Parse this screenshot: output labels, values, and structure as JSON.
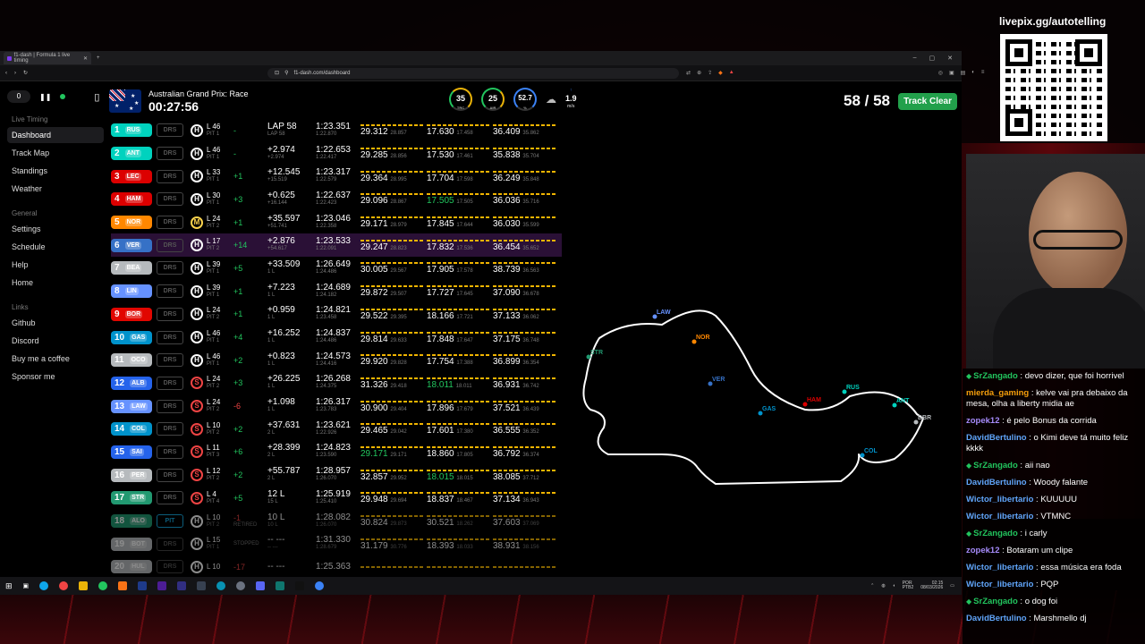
{
  "overlay": {
    "qr_title": "livepix.gg/autotelling"
  },
  "browser": {
    "tab_title": "f1-dash | Formula 1 live timing",
    "url": "f1-dash.com/dashboard"
  },
  "sidebar": {
    "delay": "0",
    "group_live": "Live Timing",
    "live_items": [
      {
        "label": "Dashboard"
      },
      {
        "label": "Track Map"
      },
      {
        "label": "Standings"
      },
      {
        "label": "Weather"
      }
    ],
    "group_general": "General",
    "general_items": [
      {
        "label": "Settings"
      },
      {
        "label": "Schedule"
      },
      {
        "label": "Help"
      },
      {
        "label": "Home"
      }
    ],
    "group_links": "Links",
    "link_items": [
      {
        "label": "Github"
      },
      {
        "label": "Discord"
      },
      {
        "label": "Buy me a coffee"
      },
      {
        "label": "Sponsor me"
      }
    ]
  },
  "header": {
    "race_title": "Australian Grand Prix: Race",
    "clock": "00:27:56",
    "track_temp": "35",
    "track_temp_label": "TRC",
    "air_temp": "25",
    "air_temp_label": "AIR",
    "humidity": "52.7",
    "humidity_label": "%",
    "wind": "1.9",
    "wind_unit": "m/s",
    "laps": "58 / 58",
    "track_status": "Track Clear"
  },
  "drivers": [
    {
      "pos": "1",
      "code": "RUS",
      "color": "#00d2be",
      "drs": "DRS",
      "tyre": "H",
      "lap": "L 46",
      "pit": "PIT 1",
      "gain": "-",
      "gain2": "",
      "gap": "LAP 58",
      "gap2": "LAP 58",
      "best": "1:23.351",
      "best2": "1:22.870",
      "s1": "29.312",
      "s1b": "28.857",
      "s2": "17.630",
      "s2b": "17.458",
      "s3": "36.409",
      "s3b": "35.862"
    },
    {
      "pos": "2",
      "code": "ANT",
      "color": "#00d2be",
      "drs": "DRS",
      "tyre": "H",
      "lap": "L 46",
      "pit": "PIT 1",
      "gain": "-",
      "gain2": "",
      "gap": "+2.974",
      "gap2": "+2.974",
      "best": "1:22.653",
      "best2": "1:22.417",
      "s1": "29.285",
      "s1b": "28.856",
      "s2": "17.530",
      "s2b": "17.461",
      "s3": "35.838",
      "s3b": "35.704"
    },
    {
      "pos": "3",
      "code": "LEC",
      "color": "#dc0000",
      "drs": "DRS",
      "tyre": "H",
      "lap": "L 33",
      "pit": "PIT 1",
      "gain": "+1",
      "gain2": "",
      "gap": "+12.545",
      "gap2": "+15.519",
      "best": "1:23.317",
      "best2": "1:22.579",
      "s1": "29.364",
      "s1b": "28.995",
      "s2": "17.704",
      "s2b": "17.598",
      "s3": "36.249",
      "s3b": "35.848"
    },
    {
      "pos": "4",
      "code": "HAM",
      "color": "#dc0000",
      "drs": "DRS",
      "tyre": "H",
      "lap": "L 30",
      "pit": "PIT 1",
      "gain": "+3",
      "gain2": "",
      "gap": "+0.625",
      "gap2": "+16.144",
      "best": "1:22.637",
      "best2": "1:22.423",
      "s1": "29.096",
      "s1b": "28.867",
      "s2": "17.505",
      "s2b": "17.505",
      "s3": "36.036",
      "s3b": "35.716"
    },
    {
      "pos": "5",
      "code": "NOR",
      "color": "#ff8700",
      "drs": "DRS",
      "tyre": "M",
      "lap": "L 24",
      "pit": "PIT 2",
      "gain": "+1",
      "gain2": "",
      "gap": "+35.597",
      "gap2": "+51.741",
      "best": "1:23.046",
      "best2": "1:22.358",
      "s1": "29.171",
      "s1b": "28.979",
      "s2": "17.845",
      "s2b": "17.644",
      "s3": "36.030",
      "s3b": "35.599"
    },
    {
      "pos": "6",
      "code": "VER",
      "color": "#3671c6",
      "drs": "DRS",
      "tyre": "H",
      "lap": "L 17",
      "pit": "PIT 2",
      "gain": "+14",
      "gain2": "",
      "gap": "+2.876",
      "gap2": "+54.617",
      "best": "1:23.533",
      "best2": "1:22.091",
      "s1": "29.247",
      "s1b": "28.823",
      "s2": "17.832",
      "s2b": "17.536",
      "s3": "36.454",
      "s3b": "35.652"
    },
    {
      "pos": "7",
      "code": "BEA",
      "color": "#b6babd",
      "drs": "DRS",
      "tyre": "H",
      "lap": "L 39",
      "pit": "PIT 1",
      "gain": "+5",
      "gain2": "",
      "gap": "+33.509",
      "gap2": "1 L",
      "best": "1:26.649",
      "best2": "1:24.486",
      "s1": "30.005",
      "s1b": "29.567",
      "s2": "17.905",
      "s2b": "17.578",
      "s3": "38.739",
      "s3b": "36.563"
    },
    {
      "pos": "8",
      "code": "LIN",
      "color": "#6692ff",
      "drs": "DRS",
      "tyre": "H",
      "lap": "L 39",
      "pit": "PIT 1",
      "gain": "+1",
      "gain2": "",
      "gap": "+7.223",
      "gap2": "1 L",
      "best": "1:24.689",
      "best2": "1:24.182",
      "s1": "29.872",
      "s1b": "29.507",
      "s2": "17.727",
      "s2b": "17.645",
      "s3": "37.090",
      "s3b": "36.678"
    },
    {
      "pos": "9",
      "code": "BOR",
      "color": "#e10600",
      "drs": "DRS",
      "tyre": "H",
      "lap": "L 24",
      "pit": "PIT 2",
      "gain": "+1",
      "gain2": "",
      "gap": "+0.959",
      "gap2": "1 L",
      "best": "1:24.821",
      "best2": "1:23.458",
      "s1": "29.522",
      "s1b": "29.395",
      "s2": "18.166",
      "s2b": "17.721",
      "s3": "37.133",
      "s3b": "36.062"
    },
    {
      "pos": "10",
      "code": "GAS",
      "color": "#0093cc",
      "drs": "DRS",
      "tyre": "H",
      "lap": "L 46",
      "pit": "PIT 1",
      "gain": "+4",
      "gain2": "",
      "gap": "+16.252",
      "gap2": "1 L",
      "best": "1:24.837",
      "best2": "1:24.486",
      "s1": "29.814",
      "s1b": "29.633",
      "s2": "17.848",
      "s2b": "17.647",
      "s3": "37.175",
      "s3b": "36.748"
    },
    {
      "pos": "11",
      "code": "OCO",
      "color": "#b6babd",
      "drs": "DRS",
      "tyre": "H",
      "lap": "L 46",
      "pit": "PIT 1",
      "gain": "+2",
      "gain2": "",
      "gap": "+0.823",
      "gap2": "1 L",
      "best": "1:24.573",
      "best2": "1:24.416",
      "s1": "29.920",
      "s1b": "29.828",
      "s2": "17.754",
      "s2b": "17.388",
      "s3": "36.899",
      "s3b": "36.354"
    },
    {
      "pos": "12",
      "code": "ALB",
      "color": "#2563eb",
      "drs": "DRS",
      "tyre": "S",
      "lap": "L 24",
      "pit": "PIT 2",
      "gain": "+3",
      "gain2": "",
      "gap": "+26.225",
      "gap2": "1 L",
      "best": "1:26.268",
      "best2": "1:24.375",
      "s1": "31.326",
      "s1b": "29.418",
      "s2": "18.011",
      "s2b": "18.011",
      "s3": "36.931",
      "s3b": "36.742"
    },
    {
      "pos": "13",
      "code": "LAW",
      "color": "#6692ff",
      "drs": "DRS",
      "tyre": "S",
      "lap": "L 24",
      "pit": "PIT 2",
      "gain": "-6",
      "gain2": "",
      "gap": "+1.098",
      "gap2": "1 L",
      "best": "1:26.317",
      "best2": "1:23.783",
      "s1": "30.900",
      "s1b": "29.404",
      "s2": "17.896",
      "s2b": "17.679",
      "s3": "37.521",
      "s3b": "36.439"
    },
    {
      "pos": "14",
      "code": "COL",
      "color": "#0093cc",
      "drs": "DRS",
      "tyre": "S",
      "lap": "L 10",
      "pit": "PIT 2",
      "gain": "+2",
      "gain2": "",
      "gap": "+37.631",
      "gap2": "2 L",
      "best": "1:23.621",
      "best2": "1:22.926",
      "s1": "29.465",
      "s1b": "29.042",
      "s2": "17.601",
      "s2b": "17.380",
      "s3": "36.555",
      "s3b": "36.352"
    },
    {
      "pos": "15",
      "code": "SAI",
      "color": "#2563eb",
      "drs": "DRS",
      "tyre": "S",
      "lap": "L 11",
      "pit": "PIT 3",
      "gain": "+6",
      "gain2": "",
      "gap": "+28.399",
      "gap2": "2 L",
      "best": "1:24.823",
      "best2": "1:23.590",
      "s1": "29.171",
      "s1b": "29.171",
      "s2": "18.860",
      "s2b": "17.805",
      "s3": "36.792",
      "s3b": "36.374"
    },
    {
      "pos": "16",
      "code": "PER",
      "color": "#b6babd",
      "drs": "DRS",
      "tyre": "S",
      "lap": "L 12",
      "pit": "PIT 2",
      "gain": "+2",
      "gain2": "",
      "gap": "+55.787",
      "gap2": "2 L",
      "best": "1:28.957",
      "best2": "1:26.070",
      "s1": "32.857",
      "s1b": "29.952",
      "s2": "18.015",
      "s2b": "18.015",
      "s3": "38.085",
      "s3b": "37.712"
    },
    {
      "pos": "17",
      "code": "STR",
      "color": "#229971",
      "drs": "DRS",
      "tyre": "S",
      "lap": "L 4",
      "pit": "PIT 4",
      "gain": "+5",
      "gain2": "",
      "gap": "12 L",
      "gap2": "15 L",
      "best": "1:25.919",
      "best2": "1:25.410",
      "s1": "29.948",
      "s1b": "29.694",
      "s2": "18.837",
      "s2b": "18.467",
      "s3": "37.134",
      "s3b": "36.943"
    },
    {
      "pos": "18",
      "code": "ALO",
      "color": "#229971",
      "drs": "PIT",
      "tyre": "H",
      "lap": "L 10",
      "pit": "PIT 2",
      "gain": "-1",
      "gain2": "RETIRED",
      "gap": "10 L",
      "gap2": "10 L",
      "best": "1:28.082",
      "best2": "1:26.070",
      "s1": "30.824",
      "s1b": "29.873",
      "s2": "30.521",
      "s2b": "18.262",
      "s3": "37.603",
      "s3b": "37.069"
    },
    {
      "pos": "19",
      "code": "BOT",
      "color": "#b6babd",
      "drs": "DRS",
      "tyre": "H",
      "lap": "L 15",
      "pit": "PIT 1",
      "gain": "",
      "gain2": "STOPPED",
      "gap": "-- ---",
      "gap2": "-- ---",
      "best": "1:31.330",
      "best2": "1:28.679",
      "s1": "31.179",
      "s1b": "30.776",
      "s2": "18.393",
      "s2b": "18.033",
      "s3": "38.931",
      "s3b": "38.156"
    },
    {
      "pos": "20",
      "code": "HUL",
      "color": "#b6babd",
      "drs": "DRS",
      "tyre": "H",
      "lap": "L 10",
      "pit": "",
      "gain": "-17",
      "gain2": "",
      "gap": "-- ---",
      "gap2": "",
      "best": "1:25.363",
      "best2": "",
      "s1": "",
      "s1b": "",
      "s2": "",
      "s2b": "",
      "s3": "",
      "s3b": ""
    }
  ],
  "map_labels": [
    {
      "code": "LAW",
      "color": "#6692ff"
    },
    {
      "code": "NOR",
      "color": "#ff8700"
    },
    {
      "code": "STR",
      "color": "#229971"
    },
    {
      "code": "VER",
      "color": "#3671c6"
    },
    {
      "code": "GAS",
      "color": "#0093cc"
    },
    {
      "code": "HAM",
      "color": "#dc0000"
    },
    {
      "code": "RUS",
      "color": "#00d2be"
    },
    {
      "code": "ANT",
      "color": "#00d2be"
    },
    {
      "code": "DBR",
      "color": "#b6babd"
    },
    {
      "code": "COL",
      "color": "#0093cc"
    }
  ],
  "taskbar": {
    "lang": "POR",
    "lang2": "PTB2",
    "time": "02:15",
    "date": "08/03/2026"
  },
  "chat": [
    {
      "user": "SrZangado",
      "color": "#22c55e",
      "gem": true,
      "text": "devo dizer, que foi horrivel"
    },
    {
      "user": "mierda_gaming",
      "color": "#f59e0b",
      "gem": false,
      "text": "kelve vai pra debaixo da mesa, olha a liberty midia ae"
    },
    {
      "user": "zopek12",
      "color": "#a78bfa",
      "gem": false,
      "text": "é pelo Bonus da corrida"
    },
    {
      "user": "DavidBertulino",
      "color": "#60a5fa",
      "gem": false,
      "text": "o Kimi deve tá muito feliz kkkk"
    },
    {
      "user": "SrZangado",
      "color": "#22c55e",
      "gem": true,
      "text": "aii nao"
    },
    {
      "user": "DavidBertulino",
      "color": "#60a5fa",
      "gem": false,
      "text": "Woody falante"
    },
    {
      "user": "Wictor_libertario",
      "color": "#60a5fa",
      "gem": false,
      "text": "KUUUUU"
    },
    {
      "user": "Wictor_libertario",
      "color": "#60a5fa",
      "gem": false,
      "text": "VTMNC"
    },
    {
      "user": "SrZangado",
      "color": "#22c55e",
      "gem": true,
      "text": "i carly"
    },
    {
      "user": "zopek12",
      "color": "#a78bfa",
      "gem": false,
      "text": "Botaram um clipe"
    },
    {
      "user": "Wictor_libertario",
      "color": "#60a5fa",
      "gem": false,
      "text": "essa música era foda"
    },
    {
      "user": "Wictor_libertario",
      "color": "#60a5fa",
      "gem": false,
      "text": "PQP"
    },
    {
      "user": "SrZangado",
      "color": "#22c55e",
      "gem": true,
      "text": "o dog foi"
    },
    {
      "user": "DavidBertulino",
      "color": "#60a5fa",
      "gem": false,
      "text": "Marshmello dj"
    }
  ]
}
